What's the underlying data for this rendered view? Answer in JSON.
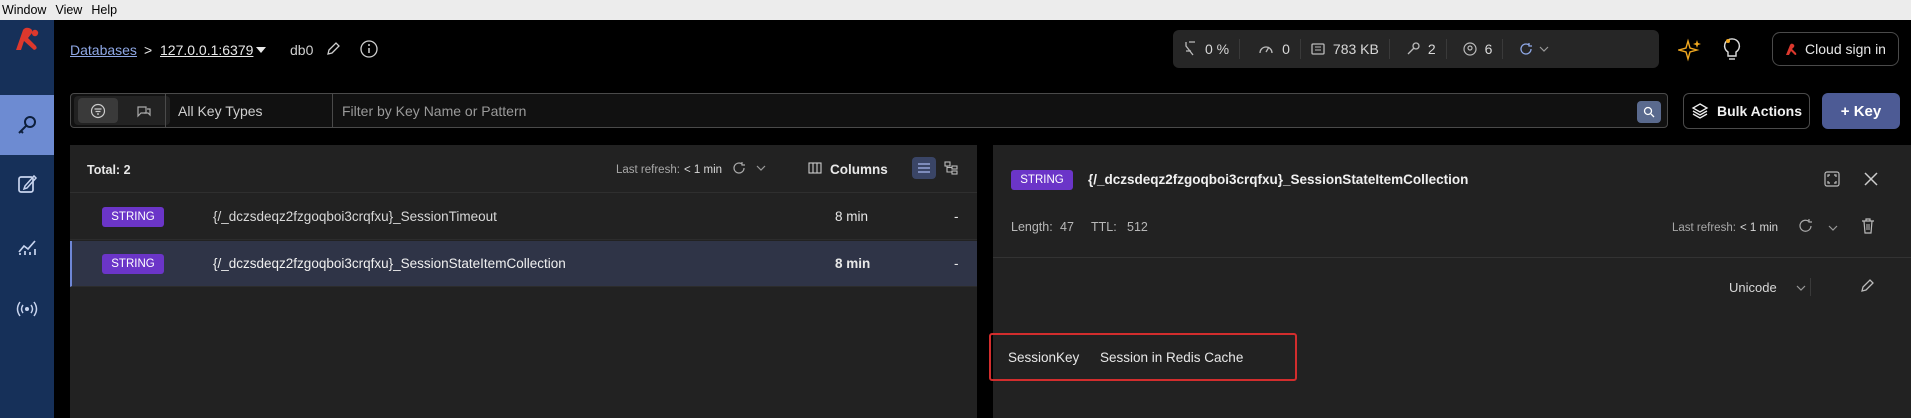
{
  "menubar": {
    "items": [
      "Window",
      "View",
      "Help"
    ]
  },
  "header": {
    "breadcrumb_root": "Databases",
    "breadcrumb_sep": ">",
    "database_name": "127.0.0.1:6379",
    "db_index": "db0"
  },
  "stats": {
    "cpu": "0 %",
    "ops": "0",
    "memory": "783 KB",
    "keys": "2",
    "clients": "6"
  },
  "cloud_signin_label": "Cloud sign in",
  "filter": {
    "key_type": "All Key Types",
    "search_placeholder": "Filter by Key Name or Pattern",
    "search_value": ""
  },
  "bulk_actions_label": "Bulk Actions",
  "add_key_label": "+ Key",
  "list": {
    "total": "Total: 2",
    "last_refresh_label": "Last refresh:",
    "last_refresh_value": "< 1 min",
    "columns_label": "Columns",
    "rows": [
      {
        "type": "STRING",
        "name": "{/_dczsdeqz2fzgoqboi3crqfxu}_SessionTimeout",
        "ttl": "8 min",
        "size": "-"
      },
      {
        "type": "STRING",
        "name": "{/_dczsdeqz2fzgoqboi3crqfxu}_SessionStateItemCollection",
        "ttl": "8 min",
        "size": "-"
      }
    ]
  },
  "detail": {
    "type": "STRING",
    "key_name": "{/_dczsdeqz2fzgoqboi3crqfxu}_SessionStateItemCollection",
    "length_label": "Length:",
    "length_value": "47",
    "ttl_label": "TTL:",
    "ttl_value": "512",
    "last_refresh_label": "Last refresh:",
    "last_refresh_value": "< 1 min",
    "format": "Unicode",
    "value_key": "SessionKey",
    "value_text": "Session in Redis Cache"
  },
  "colors": {
    "accent": "#6d8bd2",
    "sidebar": "#163059",
    "badge_string": "#6b35c8",
    "primary_button": "#4d5b95",
    "highlight_box": "#d22d2d",
    "redis_logo": "#dc382d"
  }
}
